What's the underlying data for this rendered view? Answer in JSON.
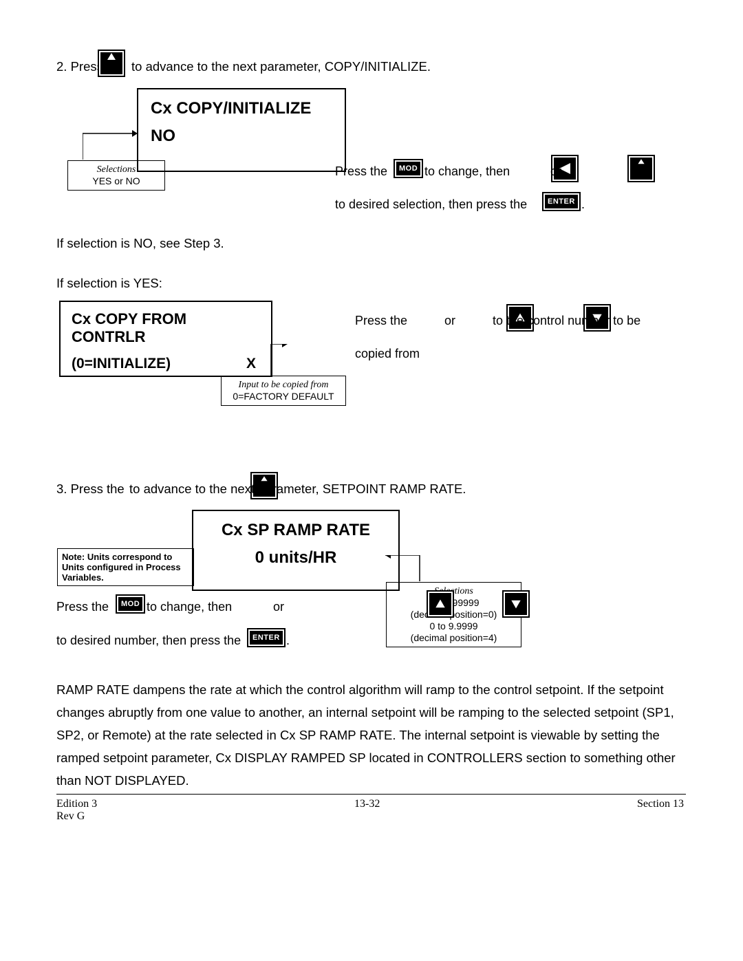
{
  "step2": {
    "prefix": "2. Press the",
    "suffix": "to advance to the next parameter, COPY/INITIALIZE.",
    "display": {
      "title": "Cx  COPY/INITIALIZE",
      "value": "NO"
    },
    "selCallout": {
      "l1": "Selections",
      "l2": "YES  or  NO"
    },
    "r1a": "Press the",
    "r1b": "to change, then",
    "r1c": "or",
    "r2a": "to desired selection, then press the",
    "r2b": ".",
    "noLine": "If selection is NO, see Step 3.",
    "yesLine": "If selection is YES:",
    "display2": {
      "title": "Cx  COPY FROM CONTRLR",
      "l2a": "(0=INITIALIZE)",
      "l2b": "X"
    },
    "copyCallout": {
      "l1": "Input to be copied from",
      "l2": "0=FACTORY DEFAULT"
    },
    "inst2a": "Press the",
    "inst2b": "or",
    "inst2c": "to the control number to be",
    "inst2d": "copied from"
  },
  "step3": {
    "prefix": "3. Press the",
    "suffix": "to advance to the next parameter, SETPOINT RAMP RATE.",
    "display": {
      "title": "Cx  SP  RAMP  RATE",
      "value": "0 units/HR"
    },
    "noteCallout": "Note:  Units correspond to Units configured in Process Variables.",
    "selCallout": {
      "l1": "Selections",
      "l2": "0 to 999999",
      "l3": "(decimal position=0)",
      "l4": "0 to 9.9999",
      "l5": "(decimal position=4)"
    },
    "ia": "Press the",
    "ib": "to change, then",
    "ic": "or",
    "id": "to desired number, then press the",
    "ie": "."
  },
  "para": "RAMP RATE dampens the rate at which the control algorithm will ramp to the control setpoint.  If the setpoint changes abruptly from one value to another, an internal setpoint will be ramping to the selected setpoint (SP1, SP2, or Remote) at the rate selected in Cx SP RAMP RATE.  The internal setpoint is viewable by setting the ramped setpoint parameter, Cx DISPLAY RAMPED SP located in CONTROLLERS section to something other than NOT DISPLAYED.",
  "btn": {
    "mod": "MOD",
    "enter": "ENTER"
  },
  "footer": {
    "left1": "Edition 3",
    "left2": "Rev G",
    "center": "13-32",
    "right": "Section 13"
  }
}
